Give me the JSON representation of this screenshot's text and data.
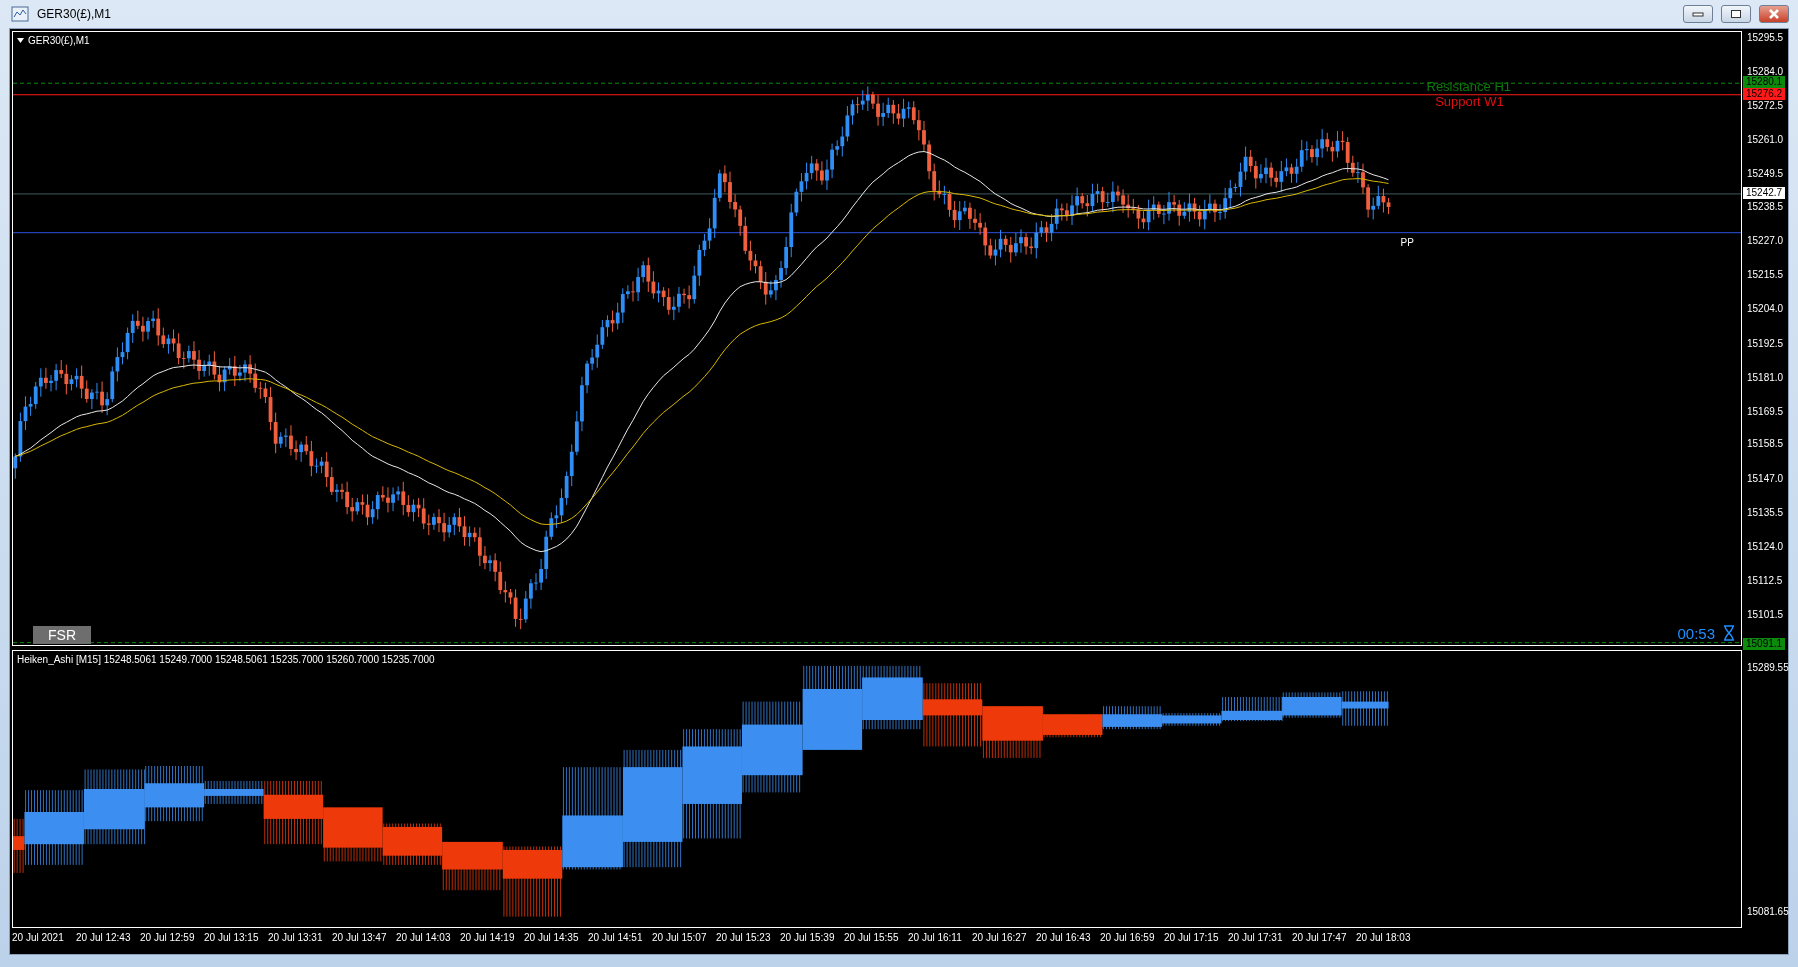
{
  "window": {
    "title": "GER30(£),M1"
  },
  "chart": {
    "symbol_label": "GER30(£),M1",
    "price_axis": [
      "15295.5",
      "15284.0",
      "15272.5",
      "15261.0",
      "15249.5",
      "15238.5",
      "15227.0",
      "15215.5",
      "15204.0",
      "15192.5",
      "15181.0",
      "15169.5",
      "15158.5",
      "15147.0",
      "15135.5",
      "15124.0",
      "15112.5",
      "15101.5"
    ],
    "price_tags": [
      {
        "text": "15280.1",
        "color": "#0b8a0b"
      },
      {
        "text": "15276.2",
        "color": "#ff1a1a"
      },
      {
        "text": "15242.7",
        "color": "#ffffff"
      },
      {
        "text": "15091.1",
        "color": "#0b8a0b"
      }
    ],
    "level_labels": [
      {
        "text": "Resistance H1",
        "color": "#0a7a0a"
      },
      {
        "text": "Support W1",
        "color": "#e01010"
      },
      {
        "text": "PP",
        "color": "#ffffff"
      }
    ],
    "fsr_button": "FSR",
    "timer": "00:53"
  },
  "indicator": {
    "label": "Heiken_Ashi [M15]  15248.5061 15249.7000 15248.5061 15235.7000 15260.7000 15235.7000",
    "axis": [
      "15289.55",
      "15081.65"
    ]
  },
  "time_axis": [
    "20 Jul 2021",
    "20 Jul 12:43",
    "20 Jul 12:59",
    "20 Jul 13:15",
    "20 Jul 13:31",
    "20 Jul 13:47",
    "20 Jul 14:03",
    "20 Jul 14:19",
    "20 Jul 14:35",
    "20 Jul 14:51",
    "20 Jul 15:07",
    "20 Jul 15:23",
    "20 Jul 15:39",
    "20 Jul 15:55",
    "20 Jul 16:11",
    "20 Jul 16:27",
    "20 Jul 16:43",
    "20 Jul 16:59",
    "20 Jul 17:15",
    "20 Jul 17:31",
    "20 Jul 17:47",
    "20 Jul 18:03"
  ]
}
